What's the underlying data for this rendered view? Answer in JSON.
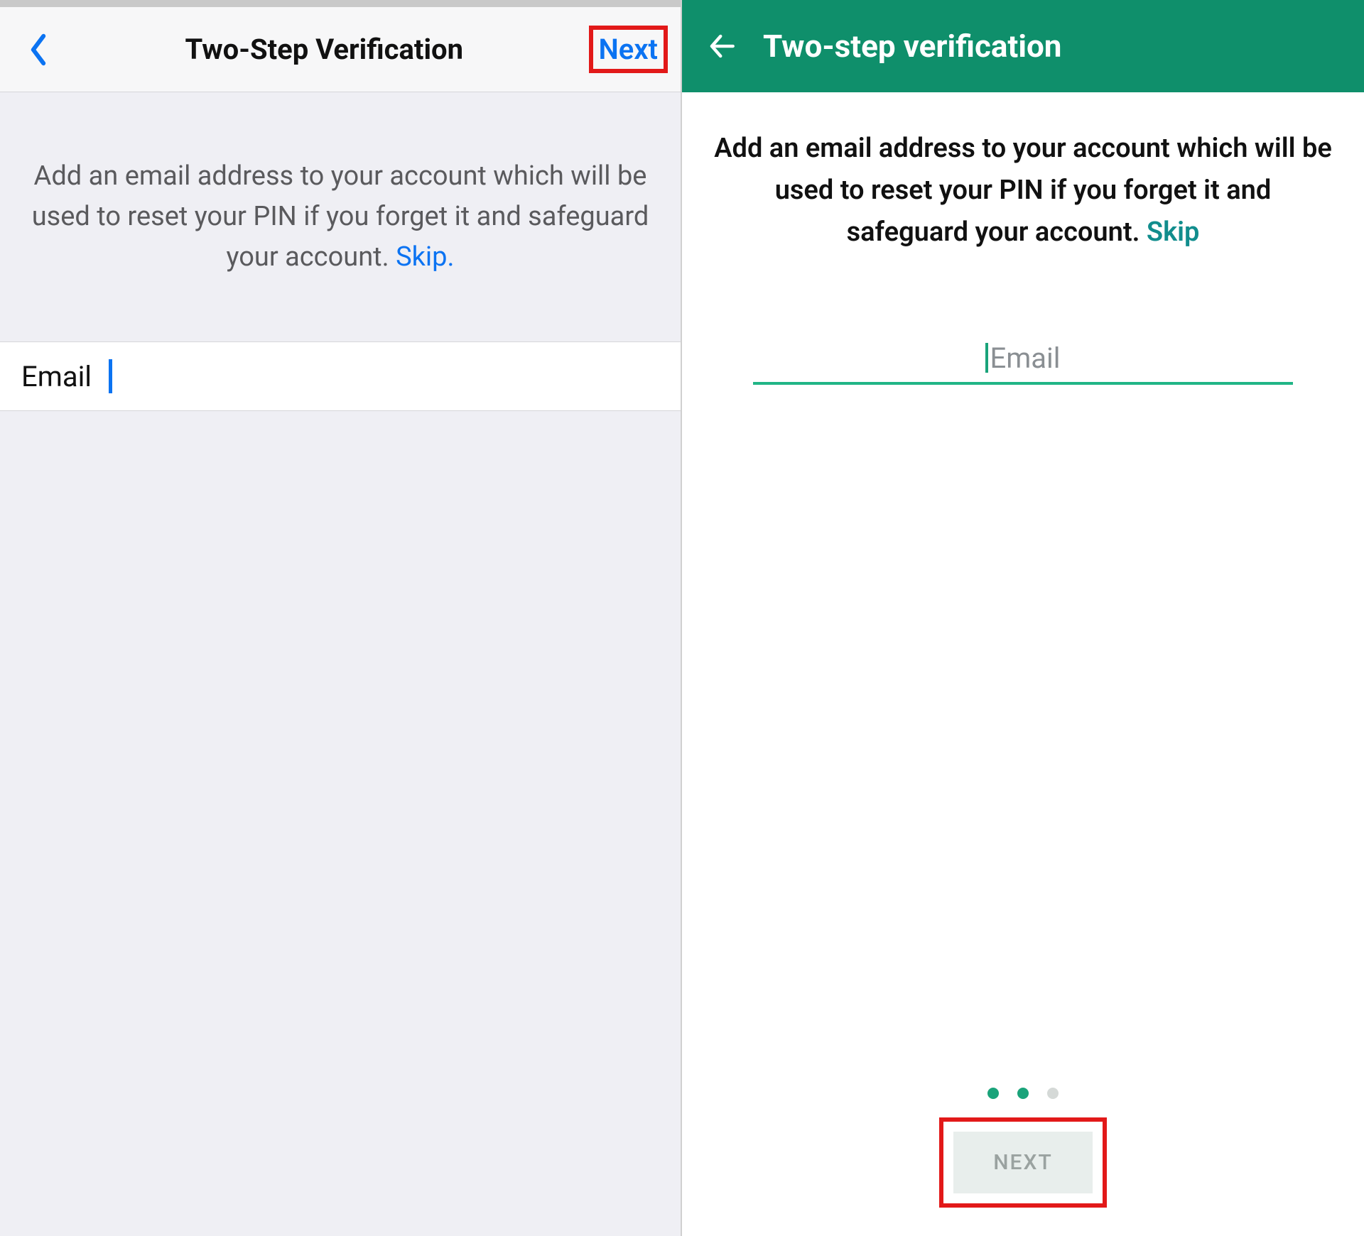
{
  "ios": {
    "header": {
      "title": "Two-Step Verification",
      "next_label": "Next"
    },
    "description": "Add an email address to your account which will be used to reset your PIN if you forget it and safeguard your account. ",
    "skip_label": "Skip.",
    "email": {
      "label": "Email",
      "value": ""
    },
    "colors": {
      "accent": "#0b73f2",
      "highlight_box": "#e21919"
    }
  },
  "android": {
    "header": {
      "title": "Two-step verification"
    },
    "description": "Add an email address to your account which will be used to reset your PIN if you forget it and safeguard your account. ",
    "skip_label": "Skip",
    "email": {
      "placeholder": "Email",
      "value": ""
    },
    "pager": {
      "total": 3,
      "active_index": 1
    },
    "next_label": "NEXT",
    "colors": {
      "brand": "#0f8f6b",
      "accent": "#1aa37a",
      "highlight_box": "#e21919"
    }
  }
}
